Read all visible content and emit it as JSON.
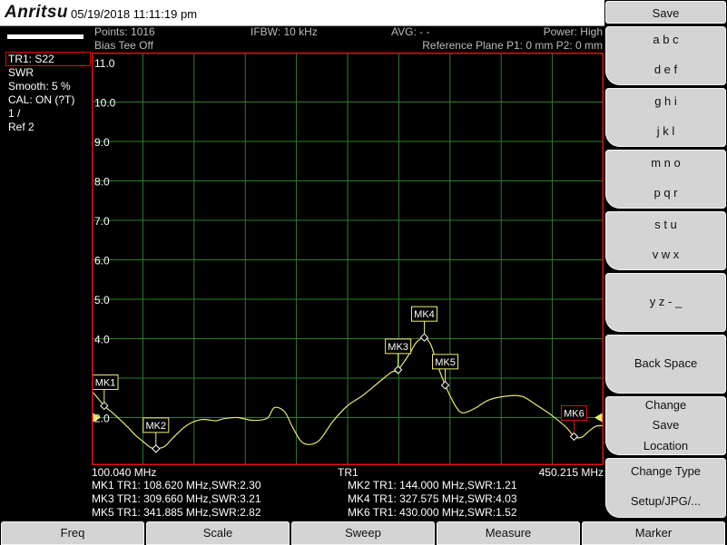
{
  "header": {
    "logo": "Anritsu",
    "datetime": "05/19/2018 11:11:19 pm"
  },
  "info": {
    "points": "Points: 1016",
    "bias_tee": "Bias Tee Off",
    "ifbw": "IFBW: 10 kHz",
    "avg": "AVG: - -",
    "power": "Power: High",
    "ref_plane": "Reference Plane P1: 0 mm P2: 0 mm"
  },
  "trace_info": {
    "trace": "TR1: S22",
    "format": "SWR",
    "smooth": "Smooth: 5 %",
    "cal": "CAL: ON (?T)",
    "scale": "1 /",
    "ref": "Ref 2"
  },
  "chart_data": {
    "type": "line",
    "y_ticks": [
      "11.0",
      "10.0",
      "9.0",
      "8.0",
      "7.0",
      "6.0",
      "5.0",
      "4.0",
      "3.0",
      "2.0"
    ],
    "ylim": [
      1.0,
      11.0
    ],
    "ref_value": 2.0,
    "x_start_label": "100.040 MHz",
    "x_mid_label": "TR1",
    "x_end_label": "450.215 MHz",
    "xlim": [
      100.04,
      450.215
    ],
    "grid": true,
    "series": [
      {
        "x": [
          100.04,
          103,
          108.62,
          115,
          125,
          130,
          135,
          140,
          144,
          150,
          156,
          165,
          175,
          185,
          190,
          200,
          210,
          220,
          225,
          232,
          238,
          245,
          255,
          265,
          275,
          285,
          295,
          305,
          309.66,
          318,
          322,
          327.575,
          332,
          336,
          341.885,
          348,
          352,
          356,
          363,
          372,
          385,
          395,
          405,
          415,
          425,
          430,
          435,
          440,
          445,
          450.215
        ],
        "y": [
          2.67,
          2.55,
          2.3,
          2.1,
          1.75,
          1.55,
          1.4,
          1.25,
          1.21,
          1.27,
          1.5,
          1.8,
          1.95,
          1.92,
          1.97,
          2.0,
          1.93,
          1.98,
          2.25,
          2.15,
          1.72,
          1.35,
          1.4,
          1.9,
          2.3,
          2.55,
          2.85,
          3.15,
          3.21,
          3.65,
          3.9,
          4.03,
          3.85,
          3.4,
          2.82,
          2.35,
          2.15,
          2.13,
          2.25,
          2.45,
          2.55,
          2.53,
          2.3,
          2.05,
          1.74,
          1.52,
          1.5,
          1.65,
          1.78,
          1.8
        ]
      }
    ],
    "markers": [
      {
        "name": "MK1",
        "freq": 108.62,
        "swr": 2.3,
        "active": false
      },
      {
        "name": "MK2",
        "freq": 144.0,
        "swr": 1.21,
        "active": false
      },
      {
        "name": "MK3",
        "freq": 309.66,
        "swr": 3.21,
        "active": false
      },
      {
        "name": "MK4",
        "freq": 327.575,
        "swr": 4.03,
        "active": false
      },
      {
        "name": "MK5",
        "freq": 341.885,
        "swr": 2.82,
        "active": false
      },
      {
        "name": "MK6",
        "freq": 430.0,
        "swr": 1.52,
        "active": true
      }
    ]
  },
  "marker_table": [
    "MK1 TR1:  108.620 MHz,SWR:2.30",
    "MK2 TR1:  144.000 MHz,SWR:1.21",
    "MK3 TR1:  309.660 MHz,SWR:3.21",
    "MK4 TR1:  327.575 MHz,SWR:4.03",
    "MK5 TR1:  341.885 MHz,SWR:2.82",
    "MK6 TR1:  430.000 MHz,SWR:1.52"
  ],
  "softkeys": {
    "save": "Save",
    "abc": "a b c",
    "def": "d e f",
    "ghi": "g h i",
    "jkl": "j k l",
    "mno": "m n o",
    "pqr": "p q r",
    "stu": "s t u",
    "vwx": "v w x",
    "yz": "y z - _",
    "backspace": "Back Space",
    "change": "Change",
    "save2": "Save",
    "location": "Location",
    "change_type": "Change Type",
    "setup": "Setup/JPG/..."
  },
  "bottom_menu": [
    "Freq",
    "Scale",
    "Sweep",
    "Measure",
    "Marker"
  ],
  "colors": {
    "grid": "#2e7d2e",
    "frame": "#e01010",
    "trace": "#e8e870",
    "marker_box": "#f0f070",
    "active_marker": "#e01010"
  }
}
